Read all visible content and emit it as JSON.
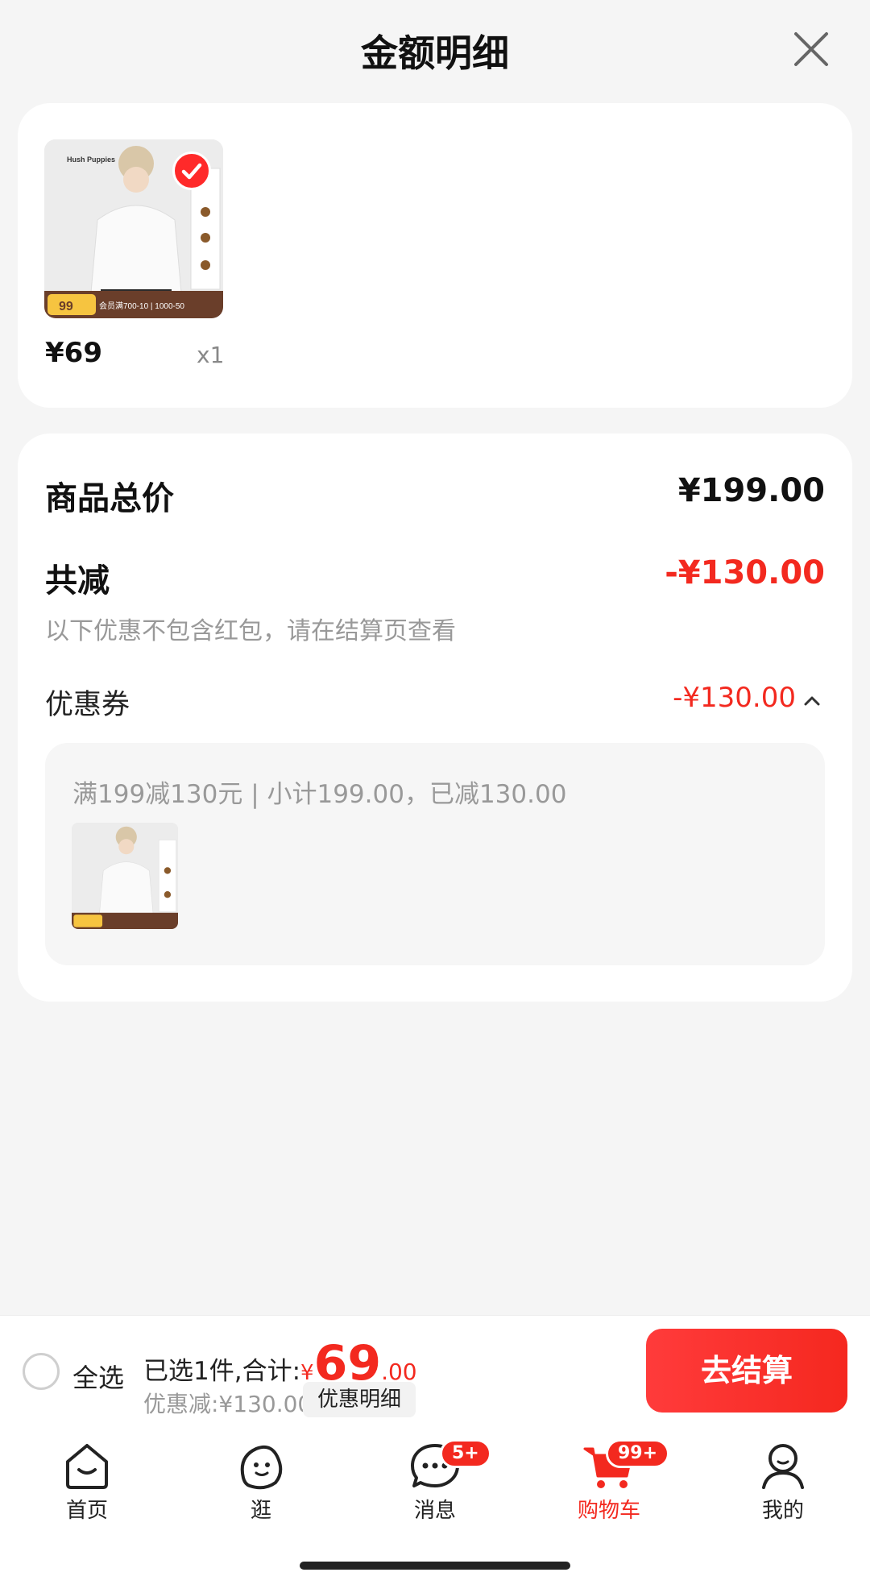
{
  "header": {
    "title": "金额明细"
  },
  "product": {
    "price": "¥69",
    "quantity": "x1",
    "thumbnail": {
      "brand_text": "Hush Puppies",
      "badge_price": "99",
      "promo_text": "会员满700-10 | 1000-50"
    }
  },
  "summary": {
    "total_label": "商品总价",
    "total_value": "¥199.00",
    "reduce_label": "共减",
    "reduce_value": "-¥130.00",
    "note": "以下优惠不包含红包，请在结算页查看",
    "coupon_label": "优惠券",
    "coupon_value": "-¥130.00",
    "coupon_detail": "满199减130元 | 小计199.00，已减130.00"
  },
  "bottom_bar": {
    "select_all": "全选",
    "selected_summary": "已选1件,合计:",
    "currency": "¥",
    "total_int": "69",
    "total_dec": ".00",
    "discount": "优惠减:¥130.00",
    "detail_button": "优惠明细",
    "checkout_button": "去结算"
  },
  "tabs": [
    {
      "label": "首页",
      "icon": "home-icon"
    },
    {
      "label": "逛",
      "icon": "explore-icon"
    },
    {
      "label": "消息",
      "icon": "message-icon",
      "badge": "5+"
    },
    {
      "label": "购物车",
      "icon": "cart-icon",
      "badge": "99+",
      "active": true
    },
    {
      "label": "我的",
      "icon": "profile-icon"
    }
  ],
  "colors": {
    "accent": "#f3291f",
    "background": "#f5f5f5",
    "card": "#ffffff"
  }
}
